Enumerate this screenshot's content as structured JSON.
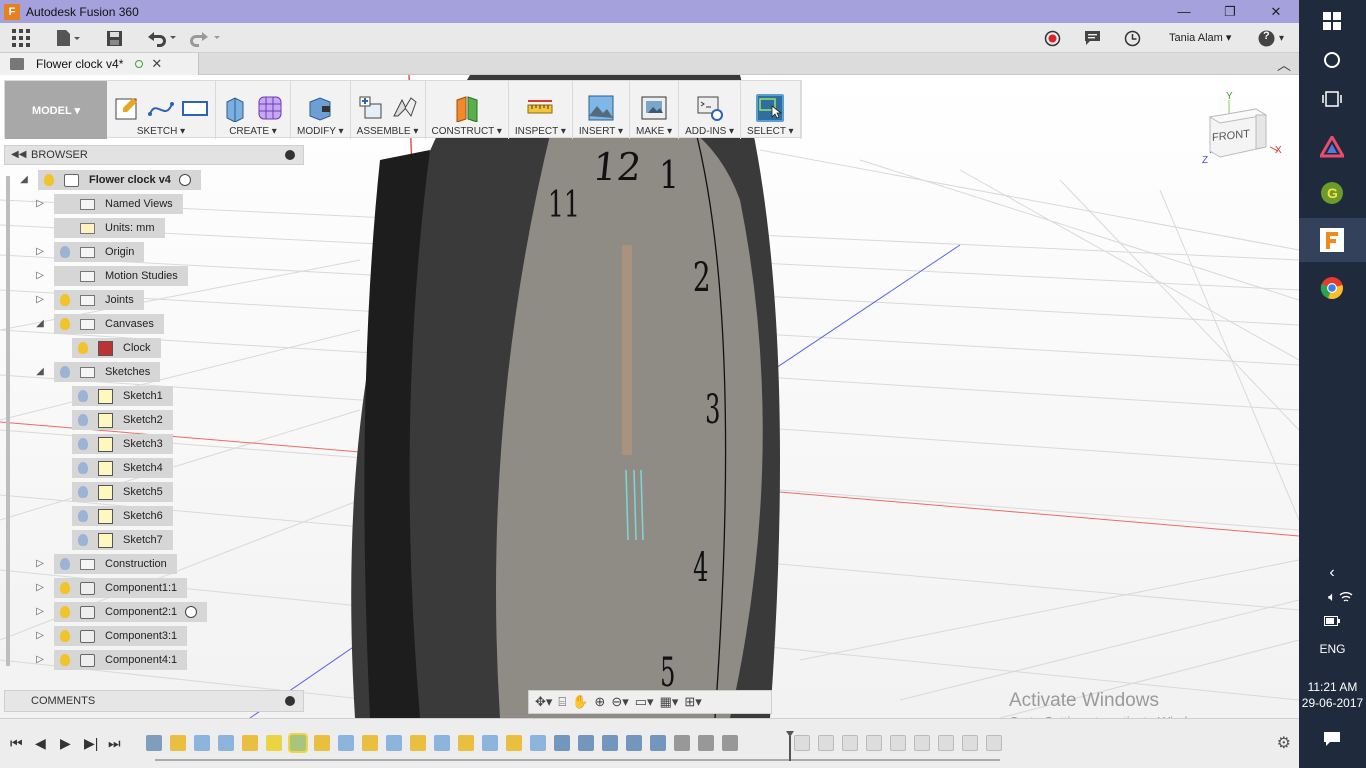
{
  "window": {
    "title": "Autodesk Fusion 360",
    "app_icon": "F",
    "controls": [
      "—",
      "❐",
      "✕"
    ]
  },
  "quick_access": {
    "user": "Tania Alam",
    "help": "?"
  },
  "document_tab": {
    "name": "Flower clock v4*"
  },
  "toolbar": {
    "workspace": "MODEL ▾",
    "groups": [
      {
        "label": "SKETCH ▾",
        "icons": [
          "sketch-icon",
          "spline-icon",
          "rectangle-icon"
        ]
      },
      {
        "label": "CREATE ▾",
        "icons": [
          "extrude-icon",
          "form-icon"
        ]
      },
      {
        "label": "MODIFY ▾",
        "icons": [
          "press-pull-icon"
        ]
      },
      {
        "label": "ASSEMBLE ▾",
        "icons": [
          "new-component-icon",
          "joint-icon"
        ]
      },
      {
        "label": "CONSTRUCT ▾",
        "icons": [
          "plane-icon"
        ]
      },
      {
        "label": "INSPECT ▾",
        "icons": [
          "measure-icon"
        ]
      },
      {
        "label": "INSERT ▾",
        "icons": [
          "insert-image-icon"
        ]
      },
      {
        "label": "MAKE ▾",
        "icons": [
          "3d-print-icon"
        ]
      },
      {
        "label": "ADD-INS ▾",
        "icons": [
          "scripts-icon"
        ]
      },
      {
        "label": "SELECT ▾",
        "icons": [
          "select-icon"
        ]
      }
    ]
  },
  "browser": {
    "title": "BROWSER",
    "items": [
      {
        "label": "Flower clock v4",
        "bulb": "on",
        "icon": "component",
        "level": 0,
        "expander": "◢",
        "radio": true,
        "bold": true
      },
      {
        "label": "Named Views",
        "bulb": "none",
        "icon": "folder",
        "level": 1,
        "expander": "▷"
      },
      {
        "label": "Units: mm",
        "bulb": "none",
        "icon": "units",
        "level": 1,
        "expander": ""
      },
      {
        "label": "Origin",
        "bulb": "off",
        "icon": "folder",
        "level": 1,
        "expander": "▷"
      },
      {
        "label": "Motion Studies",
        "bulb": "none",
        "icon": "folder",
        "level": 1,
        "expander": "▷"
      },
      {
        "label": "Joints",
        "bulb": "on",
        "icon": "folder",
        "level": 1,
        "expander": "▷"
      },
      {
        "label": "Canvases",
        "bulb": "on",
        "icon": "folder",
        "level": 1,
        "expander": "◢"
      },
      {
        "label": "Clock",
        "bulb": "on",
        "icon": "canvas",
        "level": 2,
        "expander": ""
      },
      {
        "label": "Sketches",
        "bulb": "off",
        "icon": "folder",
        "level": 1,
        "expander": "◢"
      },
      {
        "label": "Sketch1",
        "bulb": "off",
        "icon": "sketch",
        "level": 2,
        "expander": ""
      },
      {
        "label": "Sketch2",
        "bulb": "off",
        "icon": "sketch",
        "level": 2,
        "expander": ""
      },
      {
        "label": "Sketch3",
        "bulb": "off",
        "icon": "sketch",
        "level": 2,
        "expander": ""
      },
      {
        "label": "Sketch4",
        "bulb": "off",
        "icon": "sketch",
        "level": 2,
        "expander": ""
      },
      {
        "label": "Sketch5",
        "bulb": "off",
        "icon": "sketch",
        "level": 2,
        "expander": ""
      },
      {
        "label": "Sketch6",
        "bulb": "off",
        "icon": "sketch",
        "level": 2,
        "expander": ""
      },
      {
        "label": "Sketch7",
        "bulb": "off",
        "icon": "sketch",
        "level": 2,
        "expander": ""
      },
      {
        "label": "Construction",
        "bulb": "off",
        "icon": "folder",
        "level": 1,
        "expander": "▷"
      },
      {
        "label": "Component1:1",
        "bulb": "on",
        "icon": "comp",
        "level": 1,
        "expander": "▷"
      },
      {
        "label": "Component2:1",
        "bulb": "on",
        "icon": "comp",
        "level": 1,
        "expander": "▷",
        "radio": true
      },
      {
        "label": "Component3:1",
        "bulb": "on",
        "icon": "comp",
        "level": 1,
        "expander": "▷"
      },
      {
        "label": "Component4:1",
        "bulb": "on",
        "icon": "comp",
        "level": 1,
        "expander": "▷"
      }
    ]
  },
  "clock_numbers": [
    "12",
    "1",
    "2",
    "3",
    "4",
    "5",
    "11"
  ],
  "viewcube": {
    "face": "FRONT",
    "axes": [
      "Y",
      "X",
      "Z"
    ]
  },
  "comments": {
    "title": "COMMENTS"
  },
  "watermark": {
    "line1": "Activate Windows",
    "line2": "Go to Settings to activate Windows."
  },
  "taskbar": {
    "lang": "ENG",
    "time": "11:21 AM",
    "date": "29-06-2017"
  },
  "colors": {
    "titlebar": "#a5a1dc",
    "taskbar": "#1f2a3c",
    "select_accent": "#2f6e9e",
    "bulb_on": "#f2c32a",
    "bulb_off": "#9bb3d4"
  }
}
